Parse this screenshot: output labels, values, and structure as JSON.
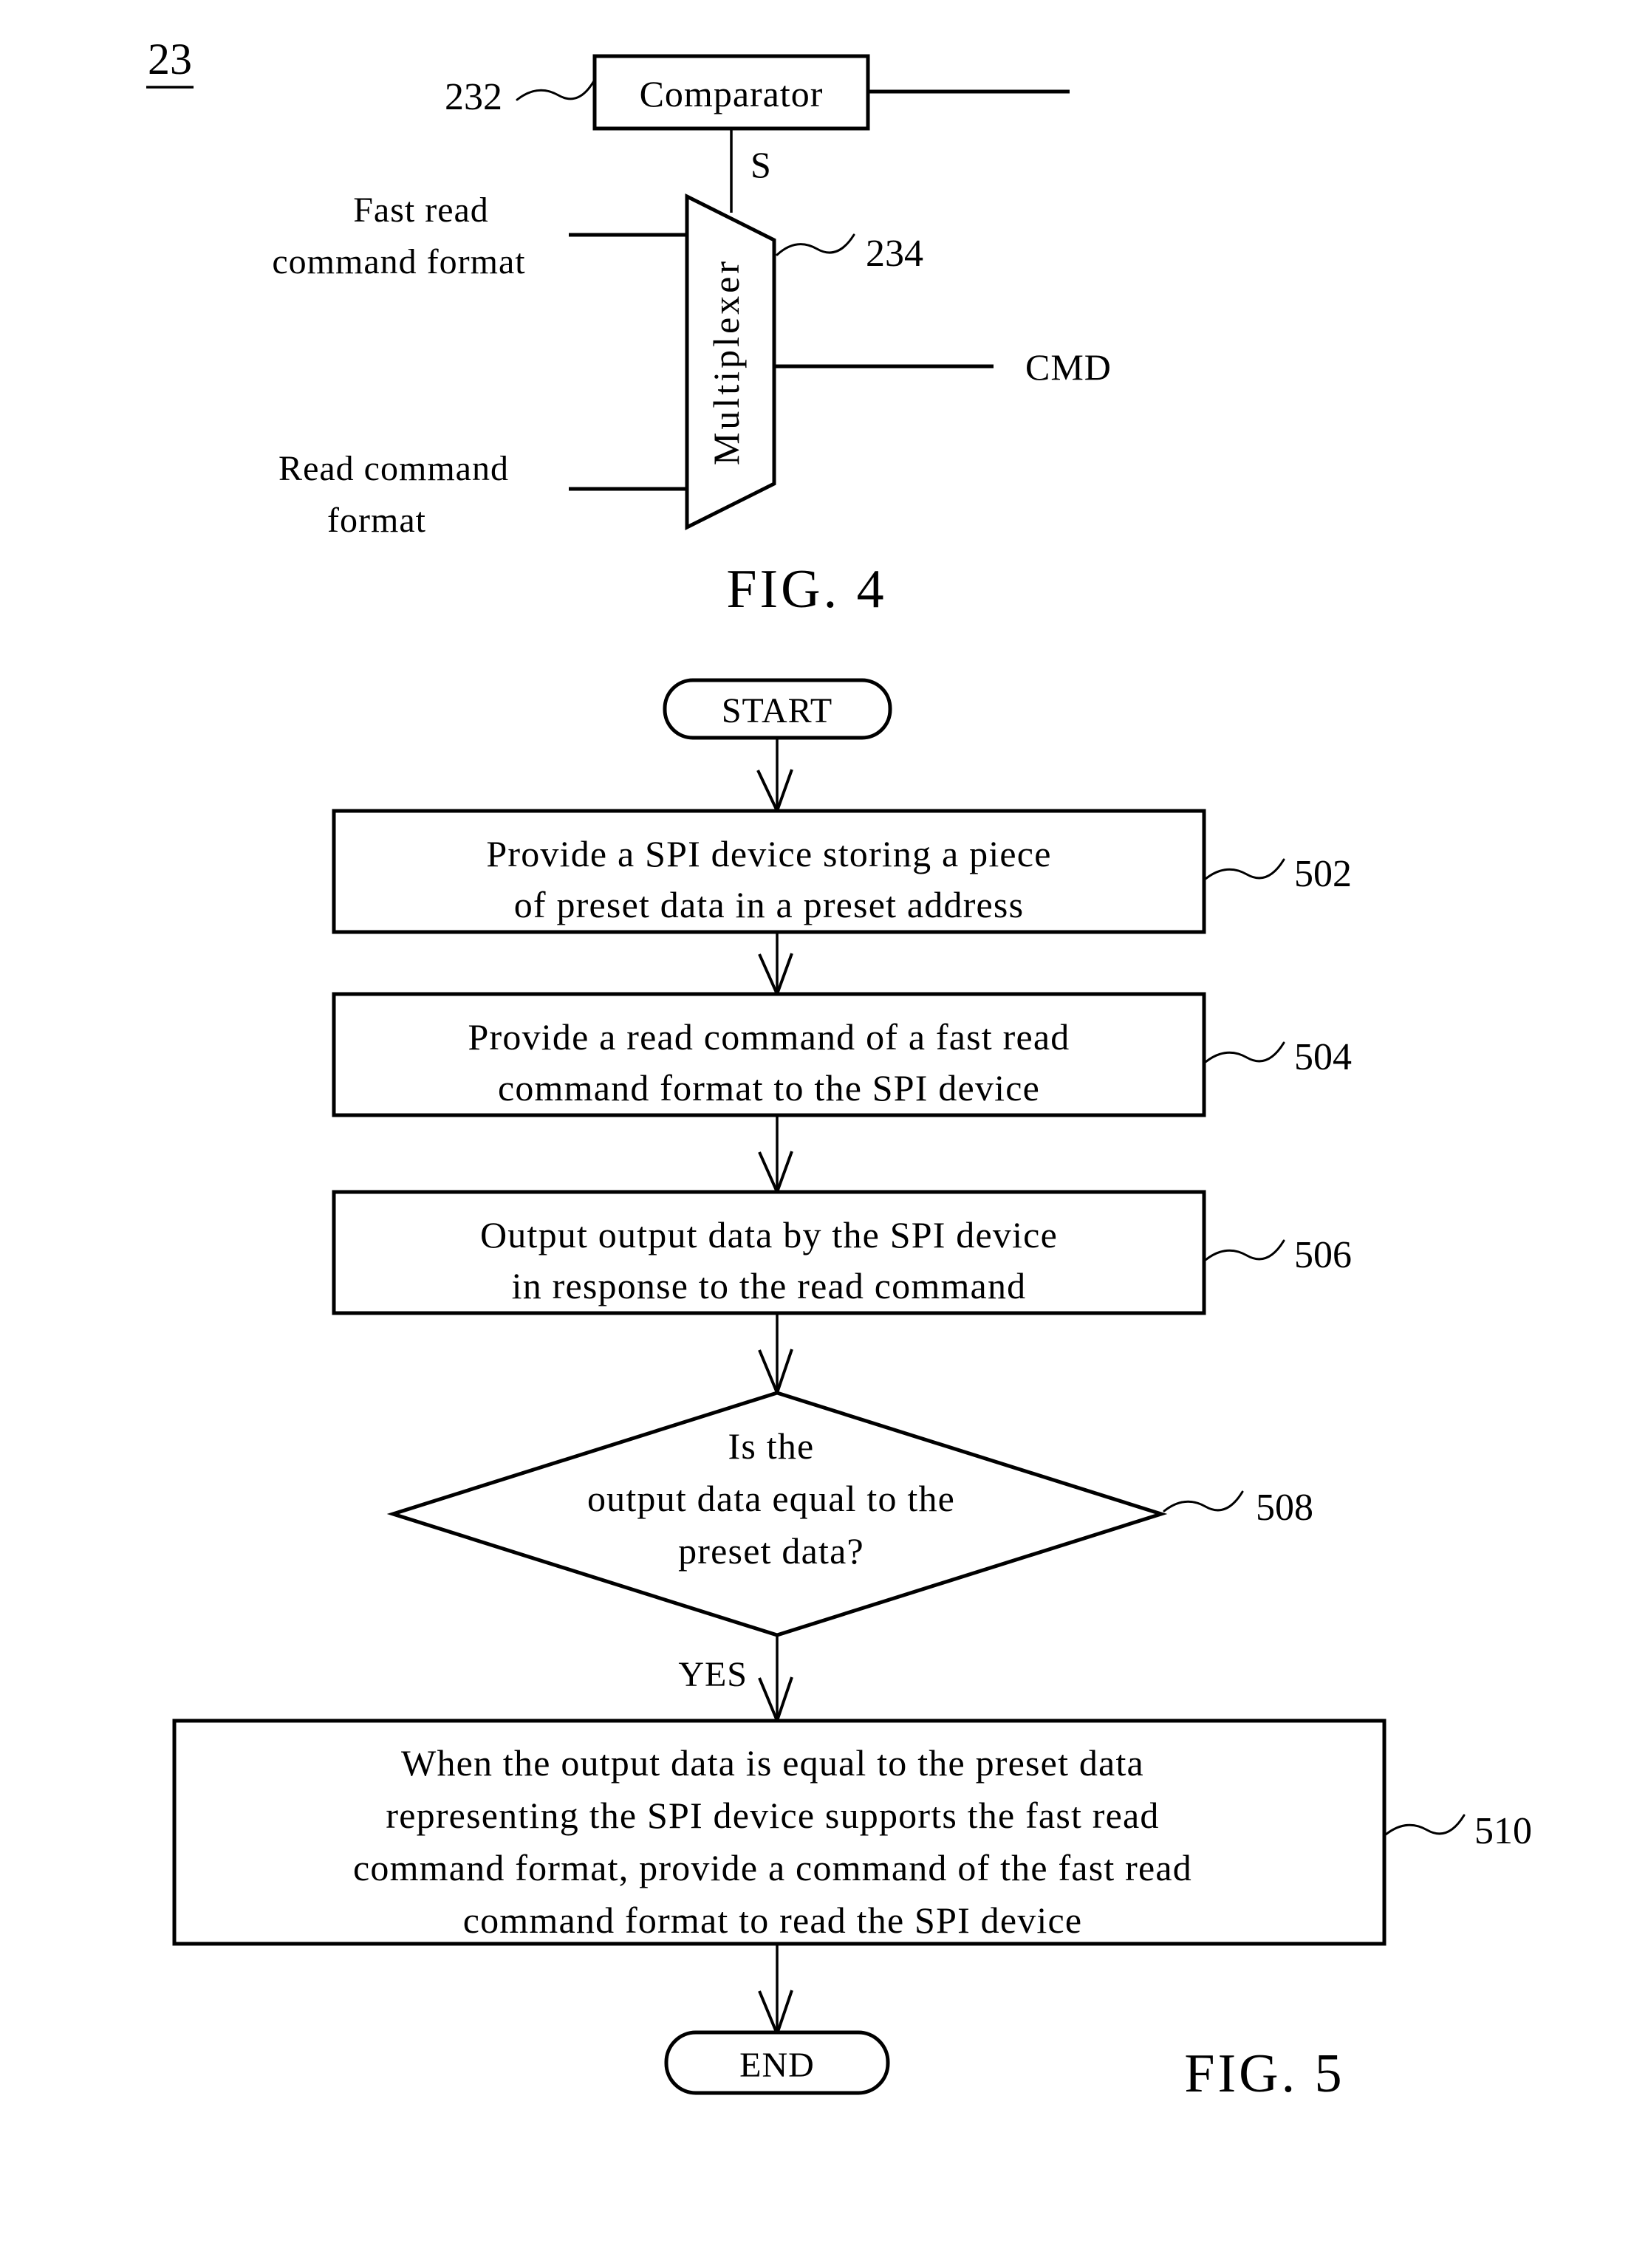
{
  "sheet": {
    "sheet_number": "23"
  },
  "fig4": {
    "caption": "FIG.  4",
    "comparator": {
      "label": "Comparator",
      "ref": "232"
    },
    "multiplexer": {
      "label": "Multiplexer",
      "ref": "234"
    },
    "signals": {
      "select": "S",
      "output": "CMD"
    },
    "inputs": [
      {
        "line1": "Fast read",
        "line2": "command format"
      },
      {
        "line1": "Read command",
        "line2": "format"
      }
    ]
  },
  "fig5": {
    "caption": "FIG.  5",
    "start_label": "START",
    "end_label": "END",
    "branch_label": "YES",
    "steps": [
      {
        "ref": "502",
        "lines": [
          "Provide a SPI device storing a piece",
          "of preset data in a preset address"
        ]
      },
      {
        "ref": "504",
        "lines": [
          "Provide a read command of a fast read",
          "command format to the SPI device"
        ]
      },
      {
        "ref": "506",
        "lines": [
          "Output output data by the SPI device",
          "in response to the read command"
        ]
      },
      {
        "ref": "510",
        "lines": [
          "When the output data is equal to the preset data",
          "representing the SPI device supports the fast read",
          "command format, provide a command of the fast read",
          "command format to read the SPI device"
        ]
      }
    ],
    "decision": {
      "ref": "508",
      "lines": [
        "Is the",
        "output data equal  to  the",
        "preset data?"
      ]
    }
  }
}
